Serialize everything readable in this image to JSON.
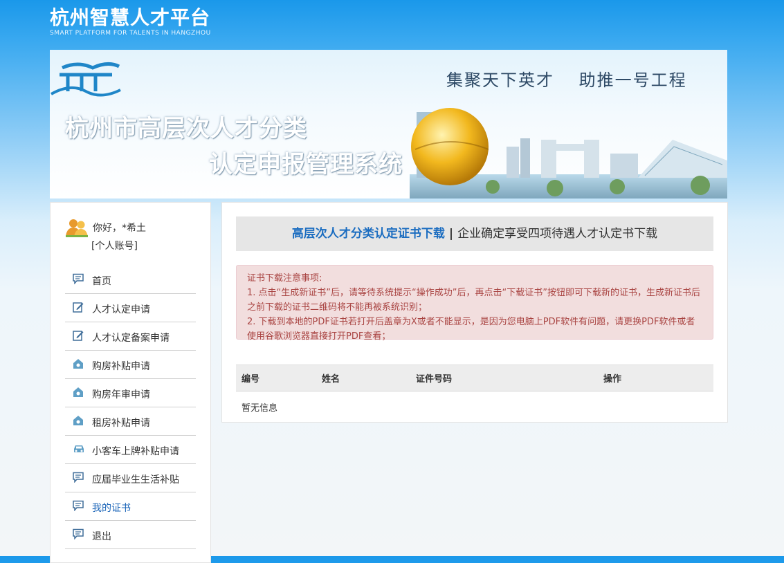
{
  "header": {
    "logo_title": "杭州智慧人才平台",
    "logo_subtitle": "SMART PLATFORM FOR TALENTS IN HANGZHOU"
  },
  "banner": {
    "slogan": "集聚天下英才　 助推一号工程",
    "title_line1": "杭州市高层次人才分类",
    "title_line2": "认定申报管理系统"
  },
  "user": {
    "greeting": "你好，*希土",
    "account_type": "[个人账号]"
  },
  "sidebar": {
    "items": [
      {
        "label": "首页",
        "icon": "chat-icon"
      },
      {
        "label": "人才认定申请",
        "icon": "edit-icon"
      },
      {
        "label": "人才认定备案申请",
        "icon": "edit-icon"
      },
      {
        "label": "购房补贴申请",
        "icon": "house-icon"
      },
      {
        "label": "购房年审申请",
        "icon": "house-icon"
      },
      {
        "label": "租房补贴申请",
        "icon": "house-icon"
      },
      {
        "label": "小客车上牌补贴申请",
        "icon": "car-icon"
      },
      {
        "label": "应届毕业生生活补贴",
        "icon": "chat-icon"
      },
      {
        "label": "我的证书",
        "icon": "chat-icon"
      },
      {
        "label": "退出",
        "icon": "chat-icon"
      }
    ],
    "active_item": "我的证书"
  },
  "main": {
    "tab_active": "高层次人才分类认定证书下载",
    "tab_separator": "|",
    "tab_other": "企业确定享受四项待遇人才认定书下载",
    "notice": {
      "title": "证书下载注意事项:",
      "line1": "1. 点击“生成新证书”后，请等待系统提示“操作成功”后，再点击“下载证书”按钮即可下载新的证书，生成新证书后之前下载的证书二维码将不能再被系统识别；",
      "line2": "2. 下载到本地的PDF证书若打开后盖章为X或者不能显示，是因为您电脑上PDF软件有问题，请更换PDF软件或者使用谷歌浏览器直接打开PDF查看；"
    },
    "table": {
      "columns": [
        "编号",
        "姓名",
        "证件号码",
        "操作"
      ],
      "empty_text": "暂无信息"
    }
  },
  "colors": {
    "header_blue": "#1a98ea",
    "link_blue": "#1a6cc0",
    "notice_text": "#a94442",
    "notice_bg": "#f2dede"
  }
}
